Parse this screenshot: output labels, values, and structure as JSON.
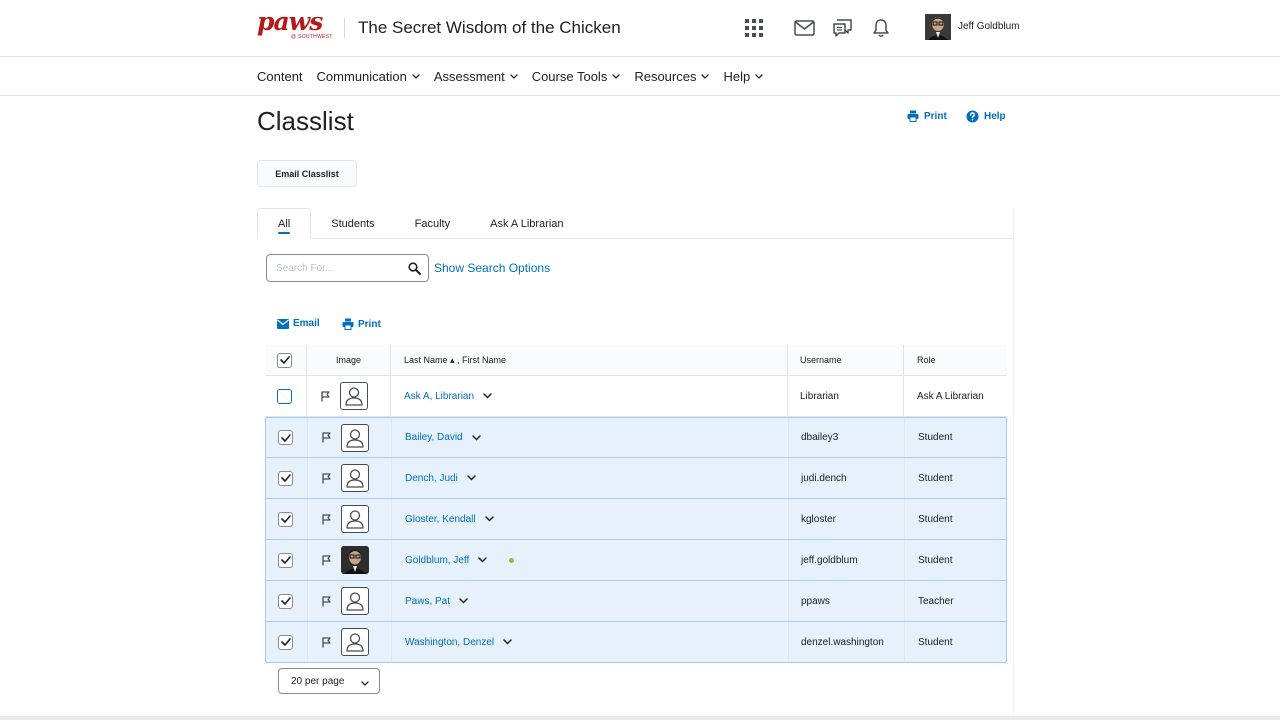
{
  "header": {
    "logo_text": "paws",
    "logo_sub": "@ SOUTHWEST",
    "course_title": "The Secret Wisdom of the Chicken",
    "user_name": "Jeff Goldblum"
  },
  "nav": {
    "items": [
      {
        "label": "Content",
        "dropdown": false
      },
      {
        "label": "Communication",
        "dropdown": true
      },
      {
        "label": "Assessment",
        "dropdown": true
      },
      {
        "label": "Course Tools",
        "dropdown": true
      },
      {
        "label": "Resources",
        "dropdown": true
      },
      {
        "label": "Help",
        "dropdown": true
      }
    ]
  },
  "page": {
    "title": "Classlist",
    "print_label": "Print",
    "help_label": "Help",
    "email_classlist_label": "Email Classlist"
  },
  "tabs": [
    {
      "label": "All",
      "active": true
    },
    {
      "label": "Students",
      "active": false
    },
    {
      "label": "Faculty",
      "active": false
    },
    {
      "label": "Ask A Librarian",
      "active": false
    }
  ],
  "search": {
    "placeholder": "Search For...",
    "value": "",
    "show_options_label": "Show Search Options"
  },
  "actions": {
    "email_label": "Email",
    "print_label": "Print"
  },
  "table": {
    "headers": {
      "image": "Image",
      "name": "Last Name ▴ , First Name",
      "username": "Username",
      "role": "Role"
    },
    "rows": [
      {
        "name": "Ask A, Librarian",
        "username": "Librarian",
        "role": "Ask A Librarian",
        "checked": false,
        "photo": false,
        "online": false
      },
      {
        "name": "Bailey, David",
        "username": "dbailey3",
        "role": "Student",
        "checked": true,
        "photo": false,
        "online": false
      },
      {
        "name": "Dench, Judi",
        "username": "judi.dench",
        "role": "Student",
        "checked": true,
        "photo": false,
        "online": false
      },
      {
        "name": "Gloster, Kendall",
        "username": "kgloster",
        "role": "Student",
        "checked": true,
        "photo": false,
        "online": false
      },
      {
        "name": "Goldblum, Jeff",
        "username": "jeff.goldblum",
        "role": "Student",
        "checked": true,
        "photo": true,
        "online": true
      },
      {
        "name": "Paws, Pat",
        "username": "ppaws",
        "role": "Teacher",
        "checked": true,
        "photo": false,
        "online": false
      },
      {
        "name": "Washington, Denzel",
        "username": "denzel.washington",
        "role": "Student",
        "checked": true,
        "photo": false,
        "online": false
      }
    ]
  },
  "pagination": {
    "per_page_label": "20 per page"
  },
  "colors": {
    "accent": "#006fbf",
    "selected_row": "#e6f1fb",
    "brand": "#b31b1b",
    "online": "#8ebd3f"
  }
}
